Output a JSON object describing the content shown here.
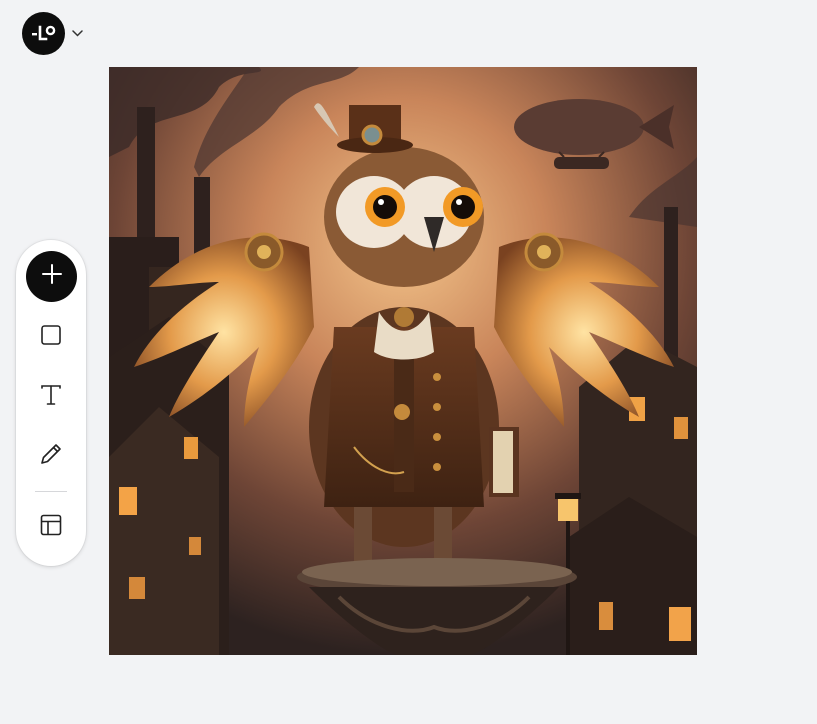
{
  "app": {
    "logo_icon": "brand-logo-icon",
    "menu_icon": "chevron-down-icon"
  },
  "canvas": {
    "image_description_icon": "generated-image",
    "colors": {
      "sky_top": "#3a2a25",
      "sky_glow": "#e8a667",
      "building_dark": "#2c1f1b",
      "window_light": "#f2a542",
      "owl_body": "#6b3f22",
      "wing_glow": "#f0b85a"
    }
  },
  "toolbar": {
    "tools": [
      {
        "id": "add",
        "icon": "plus-icon"
      },
      {
        "id": "shape",
        "icon": "square-icon"
      },
      {
        "id": "text",
        "icon": "text-icon"
      },
      {
        "id": "draw",
        "icon": "pencil-icon"
      },
      {
        "id": "template",
        "icon": "layout-icon"
      }
    ]
  }
}
